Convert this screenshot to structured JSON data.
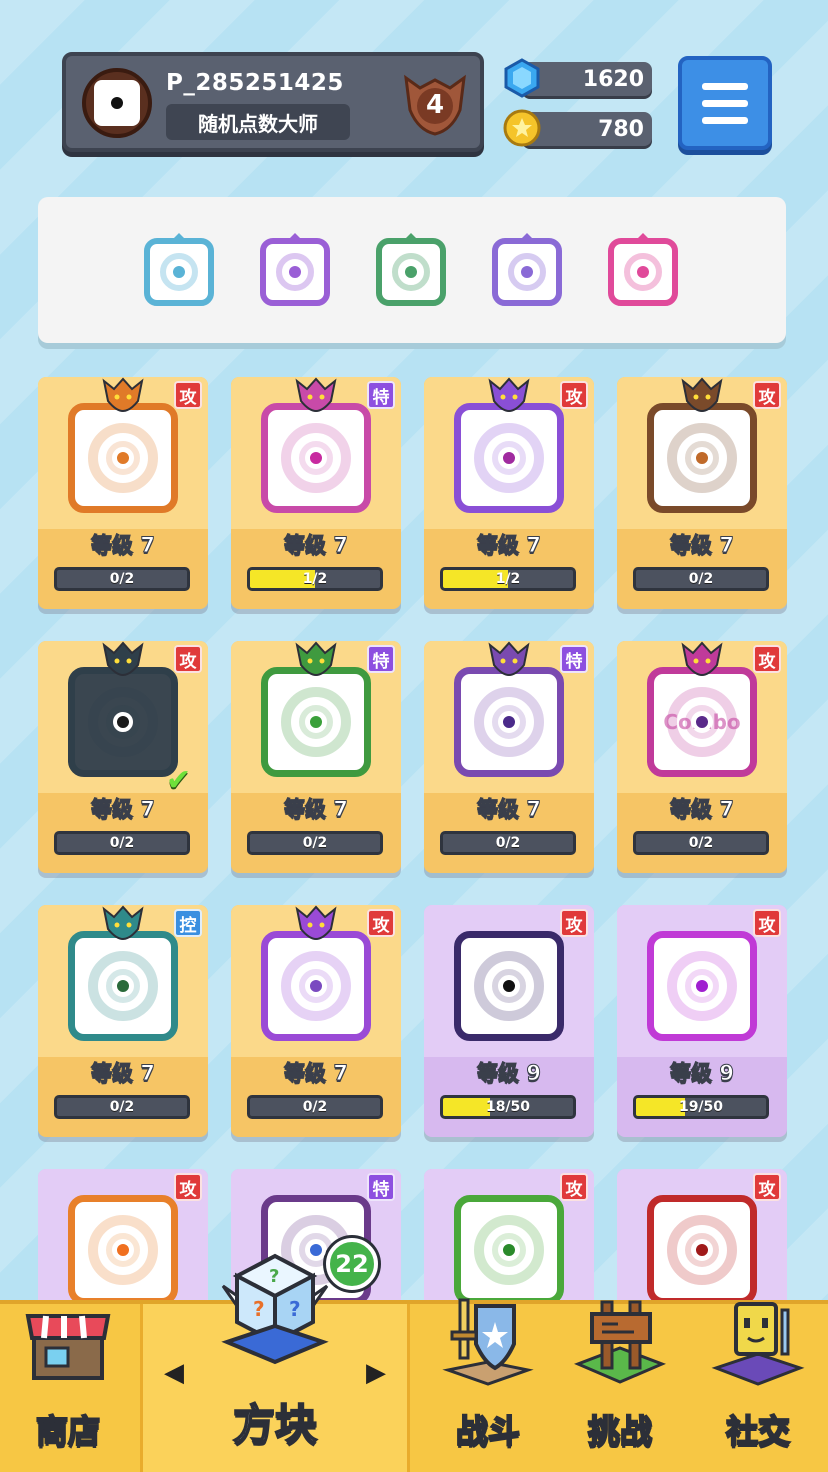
{
  "profile": {
    "player_id": "P_285251425",
    "title": "随机点数大师",
    "rank": "4"
  },
  "currency": {
    "gems": "1620",
    "coins": "780"
  },
  "menu": {
    "icon": "hamburger-menu-icon"
  },
  "deck": [
    {
      "name": "wind-die",
      "color": "#5ab3d6"
    },
    {
      "name": "gear-die",
      "color": "#9a5fd6"
    },
    {
      "name": "pentagram-die",
      "color": "#4aa16a"
    },
    {
      "name": "light-die",
      "color": "#8a6ad6"
    },
    {
      "name": "rainbow-die",
      "color": "#e04a9a"
    }
  ],
  "dice": [
    {
      "tag": "攻",
      "tag_type": "atk",
      "level": "等级 7",
      "progress": "0/2",
      "fill": 0,
      "frame": "#e07a28",
      "pip": "#e07a28",
      "bg": "gold",
      "dragon": true
    },
    {
      "tag": "特",
      "tag_type": "spc",
      "level": "等级 7",
      "progress": "1/2",
      "fill": 0.5,
      "frame": "#c84aa8",
      "pip": "#c82aa0",
      "bg": "gold",
      "dragon": true
    },
    {
      "tag": "攻",
      "tag_type": "atk",
      "level": "等级 7",
      "progress": "1/2",
      "fill": 0.5,
      "frame": "#8a4fd6",
      "pip": "#a02aa0",
      "bg": "gold",
      "dragon": true
    },
    {
      "tag": "攻",
      "tag_type": "atk",
      "level": "等级 7",
      "progress": "0/2",
      "fill": 0,
      "frame": "#7a4a2a",
      "pip": "#c06a2a",
      "bg": "gold",
      "dragon": true
    },
    {
      "tag": "攻",
      "tag_type": "atk",
      "level": "等级 7",
      "progress": "0/2",
      "fill": 0,
      "frame": "#2f3f4a",
      "pip": "#1a1a1a",
      "bg": "gold",
      "dragon": true,
      "check": true,
      "dark": true
    },
    {
      "tag": "特",
      "tag_type": "spc",
      "level": "等级 7",
      "progress": "0/2",
      "fill": 0,
      "frame": "#3f9a3f",
      "pip": "#3aa03a",
      "bg": "gold",
      "dragon": true
    },
    {
      "tag": "特",
      "tag_type": "spc",
      "level": "等级 7",
      "progress": "0/2",
      "fill": 0,
      "frame": "#7a4ab0",
      "pip": "#4a2a8a",
      "bg": "gold",
      "dragon": true
    },
    {
      "tag": "攻",
      "tag_type": "atk",
      "level": "等级 7",
      "progress": "0/2",
      "fill": 0,
      "frame": "#c03a9a",
      "pip": "#5a2a8a",
      "bg": "gold",
      "dragon": true,
      "text": "Combo"
    },
    {
      "tag": "控",
      "tag_type": "ctl",
      "level": "等级 7",
      "progress": "0/2",
      "fill": 0,
      "frame": "#2f8a8a",
      "pip": "#2a6a3a",
      "bg": "gold",
      "dragon": true
    },
    {
      "tag": "攻",
      "tag_type": "atk",
      "level": "等级 7",
      "progress": "0/2",
      "fill": 0,
      "frame": "#9a4ad6",
      "pip": "#7a4ac0",
      "bg": "gold",
      "dragon": true
    },
    {
      "tag": "攻",
      "tag_type": "atk",
      "level": "等级 9",
      "progress": "18/50",
      "fill": 0.36,
      "frame": "#3a2a6a",
      "pip": "#111111",
      "bg": "purple",
      "dragon": false
    },
    {
      "tag": "攻",
      "tag_type": "atk",
      "level": "等级 9",
      "progress": "19/50",
      "fill": 0.38,
      "frame": "#c03ad6",
      "pip": "#a020d0",
      "bg": "purple",
      "dragon": false
    },
    {
      "tag": "攻",
      "tag_type": "atk",
      "level": "",
      "progress": "",
      "fill": 0,
      "frame": "#e8802a",
      "pip": "#f07020",
      "bg": "purple",
      "dragon": false
    },
    {
      "tag": "特",
      "tag_type": "spc",
      "level": "",
      "progress": "",
      "fill": 0,
      "frame": "#6a3a8a",
      "pip": "#3a6ad6",
      "bg": "purple",
      "dragon": false
    },
    {
      "tag": "攻",
      "tag_type": "atk",
      "level": "",
      "progress": "",
      "fill": 0,
      "frame": "#4aa83a",
      "pip": "#2a8a2a",
      "bg": "purple",
      "dragon": false
    },
    {
      "tag": "攻",
      "tag_type": "atk",
      "level": "",
      "progress": "",
      "fill": 0,
      "frame": "#c02a2a",
      "pip": "#a01a1a",
      "bg": "purple",
      "dragon": false
    }
  ],
  "nav": {
    "shop": "商店",
    "dice": "方块",
    "battle": "战斗",
    "challenge": "挑战",
    "social": "社交",
    "dice_badge": "22"
  }
}
